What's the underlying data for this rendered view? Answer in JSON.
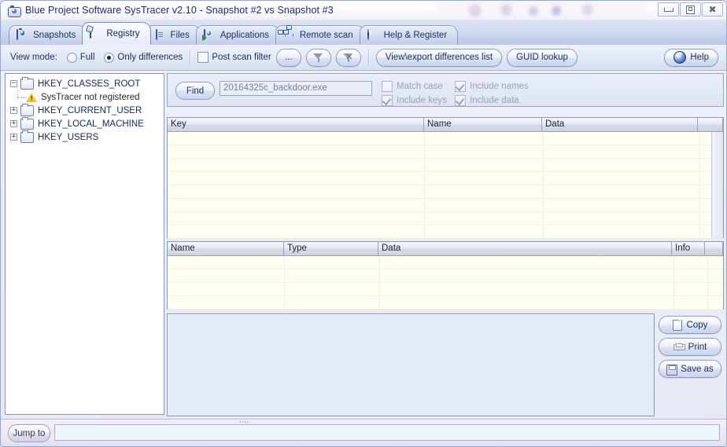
{
  "window": {
    "title": "Blue Project Software SysTracer v2.10 - Snapshot #2 vs Snapshot #3",
    "app_icon": "camera-icon",
    "controls": {
      "minimize": "minimize-icon",
      "maximize": "maximize-icon",
      "close": "close-icon"
    }
  },
  "tabs": [
    {
      "label": "Snapshots",
      "icon": "camera-icon",
      "active": false
    },
    {
      "label": "Registry",
      "icon": "registry-grid-icon",
      "active": true
    },
    {
      "label": "Files",
      "icon": "file-icon",
      "active": false
    },
    {
      "label": "Applications",
      "icon": "application-icon",
      "active": false
    },
    {
      "label": "Remote scan",
      "icon": "network-icon",
      "active": false
    },
    {
      "label": "Help & Register",
      "icon": "help-globe-icon",
      "active": false
    }
  ],
  "toolbar": {
    "view_mode_label": "View mode:",
    "radio_full": "Full",
    "radio_only_differences": "Only differences",
    "view_mode_selected": "Only differences",
    "post_scan_filter_label": "Post scan filter",
    "post_scan_filter_checked": false,
    "browse_button": "...",
    "filter_button_icon": "funnel-icon",
    "clear_filter_button_icon": "funnel-clear-icon",
    "view_export_button": "View\\export differences list",
    "guid_lookup_button": "GUID lookup",
    "help_button": "Help",
    "help_icon": "help-globe-icon"
  },
  "tree": {
    "nodes": [
      {
        "label": "HKEY_CLASSES_ROOT",
        "expander": "minus",
        "icon": "folder-icon",
        "level": 0
      },
      {
        "label": "SysTracer not registered",
        "expander": "none",
        "icon": "warning-icon",
        "level": 1
      },
      {
        "label": "HKEY_CURRENT_USER",
        "expander": "plus",
        "icon": "folder-icon",
        "level": 0
      },
      {
        "label": "HKEY_LOCAL_MACHINE",
        "expander": "plus",
        "icon": "folder-icon",
        "level": 0
      },
      {
        "label": "HKEY_USERS",
        "expander": "plus",
        "icon": "folder-icon",
        "level": 0
      }
    ]
  },
  "find": {
    "button_label": "Find",
    "input_value": "20164325c_backdoor.exe",
    "input_placeholder": "",
    "options": [
      {
        "label": "Match case",
        "checked": false,
        "disabled": true
      },
      {
        "label": "Include names",
        "checked": true,
        "disabled": true
      },
      {
        "label": "Include keys",
        "checked": true,
        "disabled": true
      },
      {
        "label": "Include data",
        "checked": true,
        "disabled": true
      }
    ]
  },
  "key_list": {
    "columns": [
      "Key",
      "Name",
      "Data"
    ],
    "rows": []
  },
  "value_list": {
    "columns": [
      "Name",
      "Type",
      "Data",
      "Info"
    ],
    "rows": []
  },
  "detail_pane": {
    "content": ""
  },
  "side_buttons": [
    {
      "label": "Copy",
      "icon": "copy-icon"
    },
    {
      "label": "Print",
      "icon": "print-icon"
    },
    {
      "label": "Save as",
      "icon": "save-icon"
    }
  ],
  "status_bar": {
    "jump_to_button": "Jump to",
    "jump_to_value": "",
    "jump_to_placeholder": ""
  },
  "colors": {
    "accent": "#17306a",
    "titlebar": "#fdfbff",
    "tabstrip": "#ccd6ef",
    "list_background": "#fffff2",
    "detail_background": "#e3eaf8",
    "warning": "#f4c52b"
  }
}
